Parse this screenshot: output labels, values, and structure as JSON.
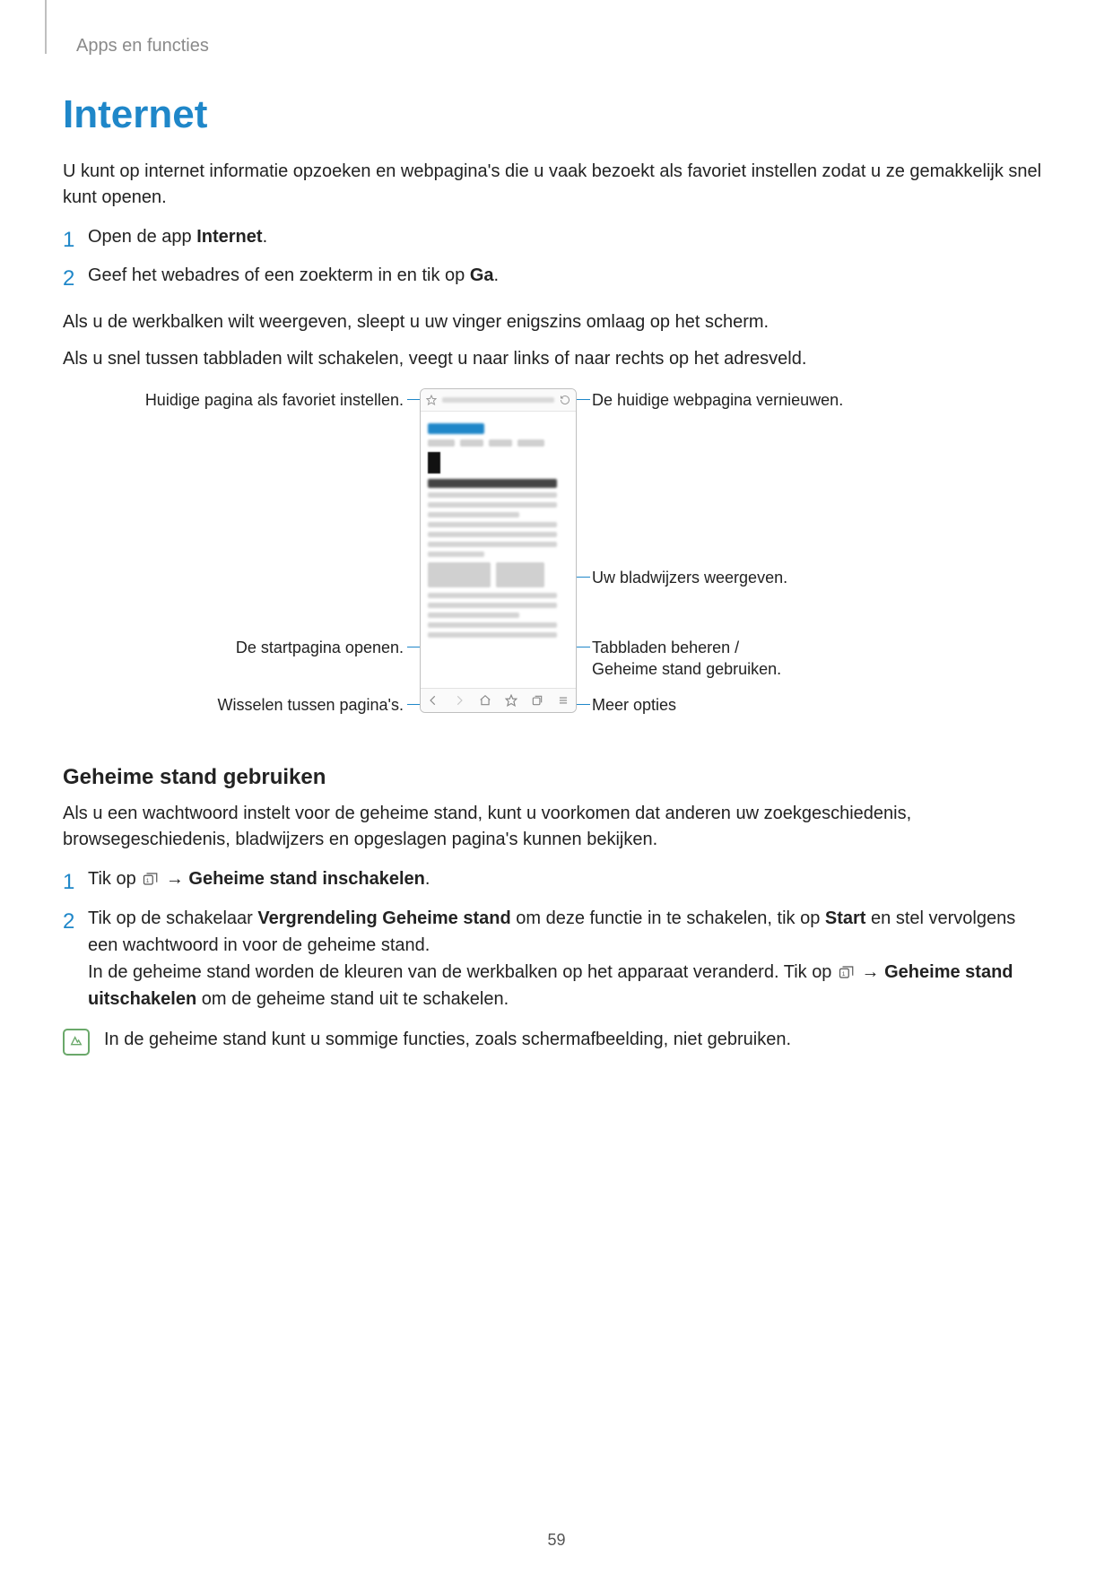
{
  "header": {
    "breadcrumb": "Apps en functies"
  },
  "title": "Internet",
  "intro": "U kunt op internet informatie opzoeken en webpagina's die u vaak bezoekt als favoriet instellen zodat u ze gemakkelijk snel kunt openen.",
  "steps1": {
    "s1": {
      "num": "1",
      "pre": "Open de app ",
      "bold": "Internet",
      "post": "."
    },
    "s2": {
      "num": "2",
      "pre": "Geef het webadres of een zoekterm in en tik op ",
      "bold": "Ga",
      "post": "."
    }
  },
  "para_toolbar": "Als u de werkbalken wilt weergeven, sleept u uw vinger enigszins omlaag op het scherm.",
  "para_tabs": "Als u snel tussen tabbladen wilt schakelen, veegt u naar links of naar rechts op het adresveld.",
  "callouts": {
    "favorite": "Huidige pagina als favoriet instellen.",
    "refresh": "De huidige webpagina vernieuwen.",
    "bookmarks": "Uw bladwijzers weergeven.",
    "home": "De startpagina openen.",
    "tabs": "Tabbladen beheren /\nGeheime stand gebruiken.",
    "nav": "Wisselen tussen pagina's.",
    "more": "Meer opties"
  },
  "secret_heading": "Geheime stand gebruiken",
  "secret_intro": "Als u een wachtwoord instelt voor de geheime stand, kunt u voorkomen dat anderen uw zoekgeschiedenis, browsegeschiedenis, bladwijzers en opgeslagen pagina's kunnen bekijken.",
  "secret_steps": {
    "s1": {
      "num": "1",
      "pre": "Tik op ",
      "arrow": " → ",
      "bold": "Geheime stand inschakelen",
      "post": "."
    },
    "s2": {
      "num": "2",
      "line1_pre": "Tik op de schakelaar ",
      "line1_bold1": "Vergrendeling Geheime stand",
      "line1_mid": " om deze functie in te schakelen, tik op ",
      "line1_bold2": "Start",
      "line1_post": " en stel vervolgens een wachtwoord in voor de geheime stand.",
      "line2_pre": "In de geheime stand worden de kleuren van de werkbalken op het apparaat veranderd. Tik op ",
      "line2_arrow": " → ",
      "line2_bold": "Geheime stand uitschakelen",
      "line2_post": " om de geheime stand uit te schakelen."
    }
  },
  "note": "In de geheime stand kunt u sommige functies, zoals schermafbeelding, niet gebruiken.",
  "page_number": "59"
}
